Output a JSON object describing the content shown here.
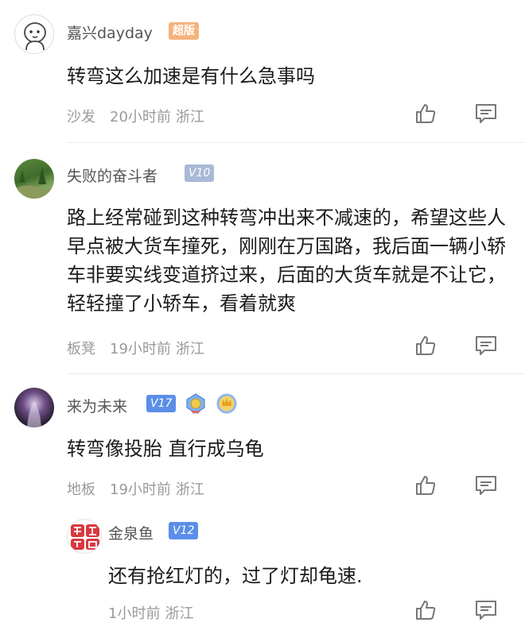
{
  "comments": [
    {
      "username": "嘉兴dayday",
      "badge": "超版",
      "text": "转弯这么加速是有什么急事吗",
      "floor": "沙发",
      "time": "20小时前",
      "location": "浙江"
    },
    {
      "username": "失败的奋斗者",
      "badge": "V10",
      "text": "路上经常碰到这种转弯冲出来不减速的，希望这些人早点被大货车撞死，刚刚在万国路，我后面一辆小轿车非要实线变道挤过来，后面的大货车就是不让它，轻轻撞了小轿车，看着就爽",
      "floor": "板凳",
      "time": "19小时前",
      "location": "浙江"
    },
    {
      "username": "来为未来",
      "badge": "V17",
      "text": "转弯像投胎 直行成乌龟",
      "floor": "地板",
      "time": "19小时前",
      "location": "浙江"
    }
  ],
  "reply": {
    "username": "金泉鱼",
    "badge": "V12",
    "avatar_text": "魚宝泉",
    "text": "还有抢红灯的，过了灯却龟速.",
    "time": "1小时前",
    "location": "浙江"
  },
  "icons": {
    "like": "thumbs-up-icon",
    "reply": "comment-icon"
  },
  "colors": {
    "badge_super": "#f5b37c",
    "badge_v": "#a9b9d6",
    "badge_v_high": "#5a8ee8",
    "meta_text": "#9a9a9a"
  }
}
